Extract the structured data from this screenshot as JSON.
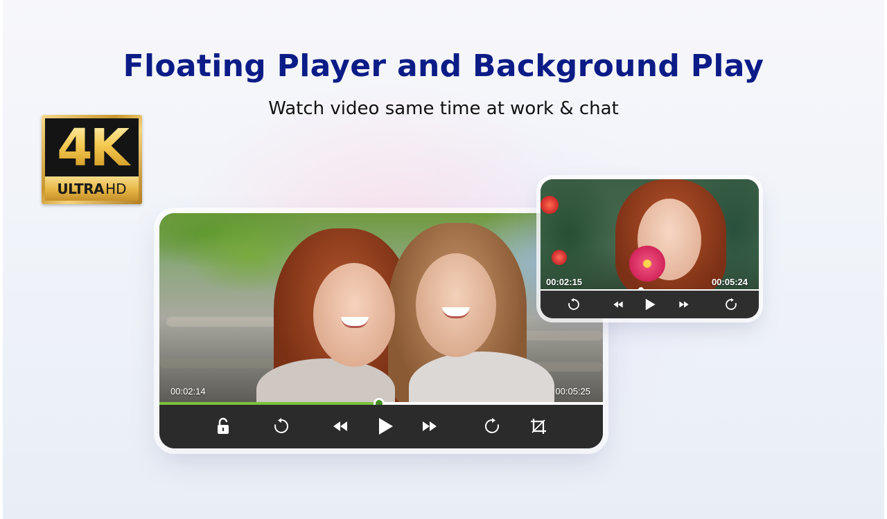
{
  "header": {
    "title": "Floating Player and Background Play",
    "subtitle": "Watch video same time at work & chat"
  },
  "badge": {
    "main_text": "4K",
    "ultra_text": "ULTRA",
    "hd_text": "HD"
  },
  "main_player": {
    "current_time": "00:02:14",
    "total_time": "00:05:25",
    "progress_fraction": 0.495,
    "controls": [
      "lock-icon",
      "rewind-10-icon",
      "skip-back-icon",
      "play-icon",
      "skip-forward-icon",
      "forward-10-icon",
      "crop-icon"
    ]
  },
  "float_player": {
    "current_time": "00:02:15",
    "total_time": "00:05:24",
    "progress_fraction": 0.46,
    "controls": [
      "rewind-10-icon",
      "skip-back-icon",
      "play-icon",
      "skip-forward-icon",
      "forward-10-icon"
    ]
  },
  "colors": {
    "title": "#0c1c87",
    "seek_fill": "#7cc23a",
    "seek_thumb": "#3f8f1d",
    "controls_bar": "#2b2b2b"
  }
}
